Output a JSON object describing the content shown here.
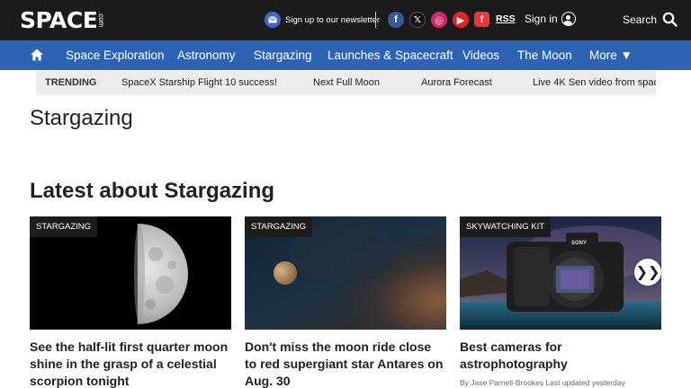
{
  "header": {
    "logo": "SPACE",
    "logo_suffix": ".com",
    "newsletter": "Sign up to our newsletter",
    "social": {
      "facebook": "f",
      "x": "𝕏",
      "instagram": "◎",
      "youtube": "▶",
      "flipboard": "f"
    },
    "rss": "RSS",
    "signin": "Sign in",
    "search": "Search"
  },
  "nav": {
    "items": [
      "Space Exploration",
      "Astronomy",
      "Stargazing",
      "Launches & Spacecraft",
      "Videos",
      "The Moon",
      "More ▼"
    ]
  },
  "trending": {
    "label": "TRENDING",
    "items": [
      "SpaceX Starship Flight 10 success!",
      "Next Full Moon",
      "Aurora Forecast",
      "Live 4K Sen video from spac"
    ]
  },
  "page": {
    "title": "Stargazing",
    "section_title": "Latest about Stargazing"
  },
  "cards": [
    {
      "tag": "STARGAZING",
      "title": "See the half-lit first quarter moon shine in the grasp of a celestial scorpion tonight"
    },
    {
      "tag": "STARGAZING",
      "title": "Don't miss the moon ride close to red supergiant star Antares on Aug. 30"
    },
    {
      "tag": "SKYWATCHING KIT",
      "title": "Best cameras for astrophotography",
      "byline": "By Jase Parnell-Brookes Last updated yesterday"
    }
  ],
  "carousel": {
    "next": "❯❯"
  },
  "colors": {
    "header_bg": "#1b1b1b",
    "nav_bg": "#2c63b3",
    "trending_bg": "#ececec"
  }
}
